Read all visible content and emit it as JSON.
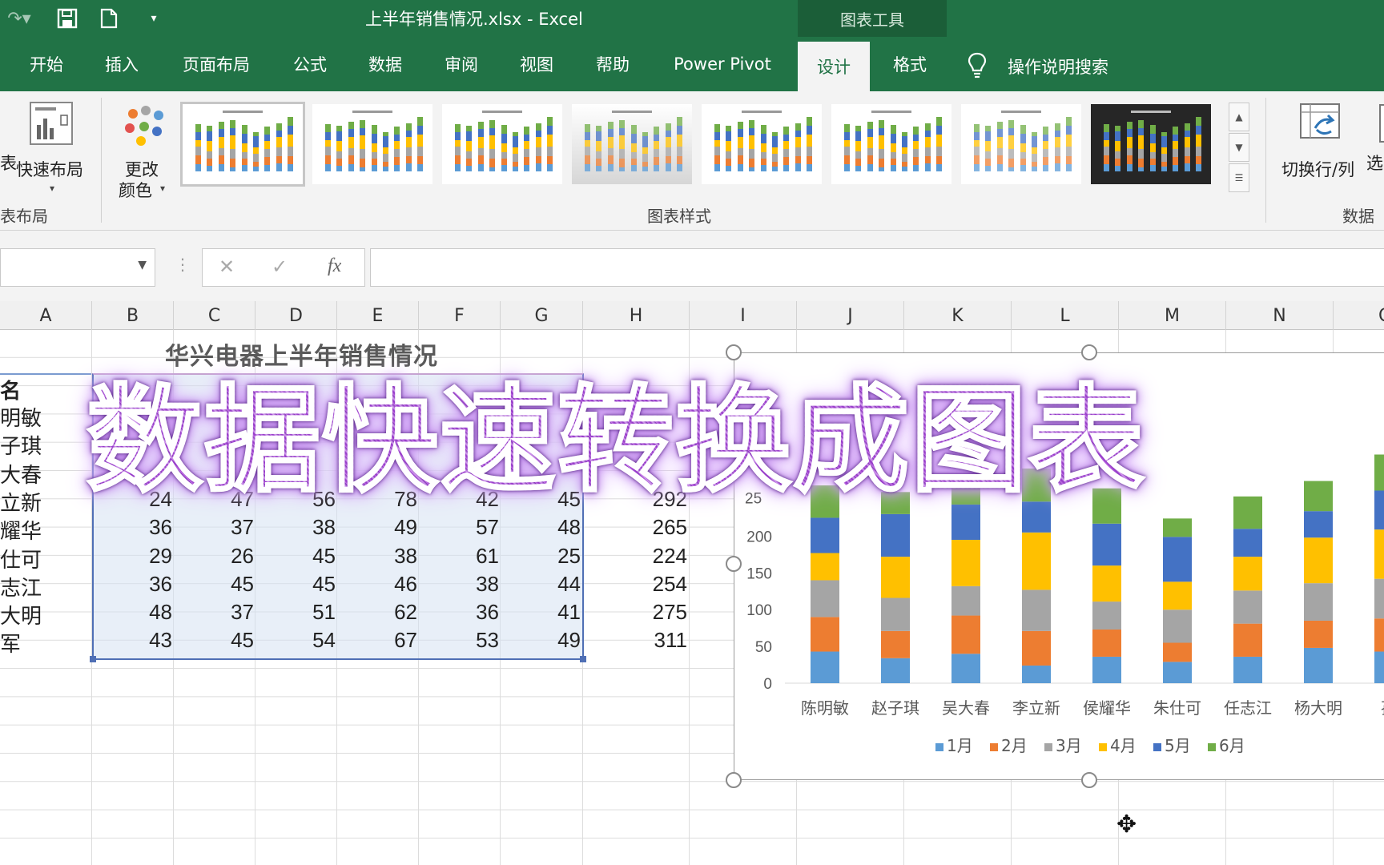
{
  "title_bar": {
    "window_title": "上半年销售情况.xlsx  -  Excel",
    "context_tab_group": "图表工具"
  },
  "tabs": [
    {
      "label": "开始"
    },
    {
      "label": "插入"
    },
    {
      "label": "页面布局"
    },
    {
      "label": "公式"
    },
    {
      "label": "数据"
    },
    {
      "label": "审阅"
    },
    {
      "label": "视图"
    },
    {
      "label": "帮助"
    },
    {
      "label": "Power Pivot"
    },
    {
      "label": "设计",
      "active": true
    },
    {
      "label": "格式"
    }
  ],
  "tell_me": {
    "label": "操作说明搜索",
    "icon": "lightbulb-icon"
  },
  "ribbon": {
    "quick_layout_left_fragment": "表",
    "quick_layout_label": "快速布局",
    "chart_layouts_group_fragment": "表布局",
    "change_colors_line1": "更改",
    "change_colors_line2": "颜色",
    "chart_styles_group": "图表样式",
    "switch_row_col": "切换行/列",
    "select_data_fragment": "选",
    "data_group": "数据"
  },
  "formula_bar": {
    "cancel_icon": "✕",
    "enter_icon": "✓",
    "fx_label": "fx"
  },
  "column_headers": [
    "A",
    "B",
    "C",
    "D",
    "E",
    "F",
    "G",
    "H",
    "I",
    "J",
    "K",
    "L",
    "M",
    "N",
    "C"
  ],
  "sheet": {
    "title": "华兴电器上半年销售情况",
    "header_cell_fragment": "名",
    "rows": [
      {
        "name": "明敏",
        "values": [
          "",
          "",
          "",
          "",
          "",
          ""
        ],
        "total": ""
      },
      {
        "name": "子琪",
        "values": [
          "",
          "",
          "",
          "",
          "",
          ""
        ],
        "total": ""
      },
      {
        "name": "大春",
        "values": [
          "",
          "",
          "",
          "",
          "",
          ""
        ],
        "total": ""
      },
      {
        "name": "立新",
        "values": [
          "24",
          "47",
          "56",
          "78",
          "42",
          "45"
        ],
        "total": "292"
      },
      {
        "name": "耀华",
        "values": [
          "36",
          "37",
          "38",
          "49",
          "57",
          "48"
        ],
        "total": "265"
      },
      {
        "name": "仕可",
        "values": [
          "29",
          "26",
          "45",
          "38",
          "61",
          "25"
        ],
        "total": "224"
      },
      {
        "name": "志江",
        "values": [
          "36",
          "45",
          "45",
          "46",
          "38",
          "44"
        ],
        "total": "254"
      },
      {
        "name": "大明",
        "values": [
          "48",
          "37",
          "51",
          "62",
          "36",
          "41"
        ],
        "total": "275"
      },
      {
        "name": "军",
        "values": [
          "43",
          "45",
          "54",
          "67",
          "53",
          "49"
        ],
        "total": "311"
      }
    ]
  },
  "overlay_caption": "数据快速转换成图表",
  "chart_data": {
    "type": "bar",
    "stacked": true,
    "categories": [
      "陈明敏",
      "赵子琪",
      "吴大春",
      "李立新",
      "侯耀华",
      "朱仕可",
      "任志江",
      "杨大明",
      "孙"
    ],
    "series": [
      {
        "name": "1月",
        "color": "#5b9bd5",
        "values": [
          43,
          34,
          40,
          24,
          36,
          29,
          36,
          48,
          43
        ]
      },
      {
        "name": "2月",
        "color": "#ed7d31",
        "values": [
          47,
          37,
          52,
          47,
          37,
          26,
          45,
          37,
          45
        ]
      },
      {
        "name": "3月",
        "color": "#a5a5a5",
        "values": [
          50,
          45,
          40,
          56,
          38,
          45,
          45,
          51,
          54
        ]
      },
      {
        "name": "4月",
        "color": "#ffc000",
        "values": [
          37,
          56,
          63,
          78,
          49,
          38,
          46,
          62,
          67
        ]
      },
      {
        "name": "5月",
        "color": "#4472c4",
        "values": [
          48,
          58,
          48,
          42,
          57,
          61,
          38,
          36,
          53
        ]
      },
      {
        "name": "6月",
        "color": "#70ad47",
        "values": [
          44,
          30,
          40,
          45,
          48,
          25,
          44,
          41,
          49
        ]
      }
    ],
    "y_ticks": [
      0,
      50,
      100,
      150,
      200
    ],
    "partial_tick_label": "25",
    "ylim": [
      0,
      250
    ],
    "legend_position": "bottom",
    "gridlines": false
  }
}
